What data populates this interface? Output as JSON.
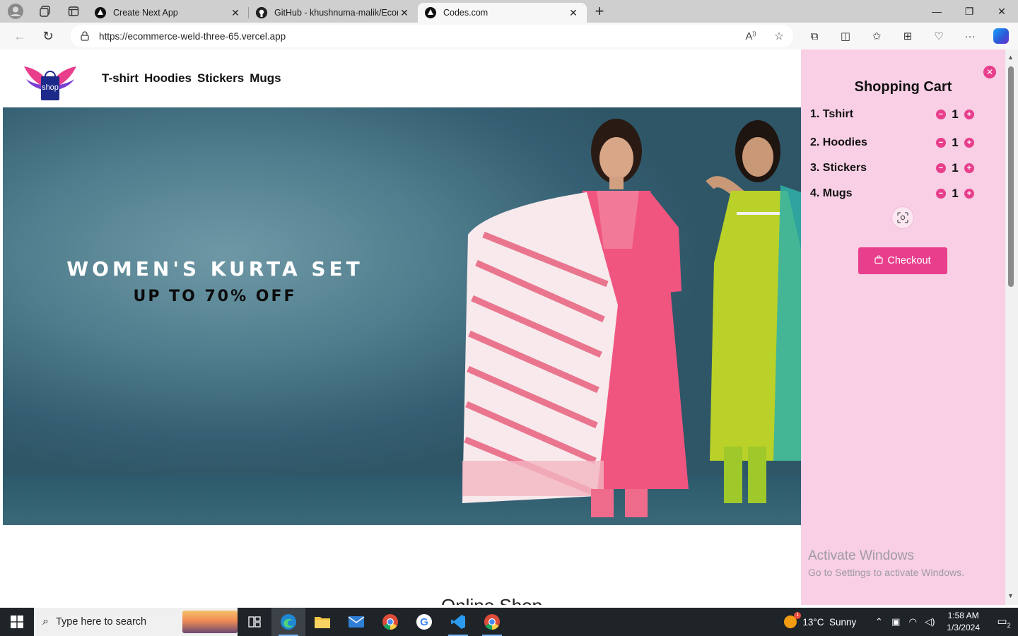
{
  "browser": {
    "tabs": [
      {
        "title": "Create Next App",
        "icon": "nextjs-icon",
        "active": false
      },
      {
        "title": "GitHub - khushnuma-malik/Ecom",
        "icon": "github-icon",
        "active": false
      },
      {
        "title": "Codes.com",
        "icon": "nextjs-icon",
        "active": true
      }
    ],
    "new_tab": "+",
    "address": {
      "url": "https://ecommerce-weld-three-65.vercel.app"
    }
  },
  "site": {
    "logo_text": "shop",
    "nav": [
      "T-shirt",
      "Hoodies",
      "Stickers",
      "Mugs"
    ],
    "hero": {
      "headline": "WOMEN'S KURTA SET",
      "subheadline": "UP TO 70% OFF"
    },
    "section_title": "Online Shop"
  },
  "cart": {
    "title": "Shopping Cart",
    "items": [
      {
        "label": "1. Tshirt",
        "qty": "1"
      },
      {
        "label": "2. Hoodies",
        "qty": "1"
      },
      {
        "label": "3. Stickers",
        "qty": "1"
      },
      {
        "label": "4. Mugs",
        "qty": "1"
      }
    ],
    "checkout_label": "Checkout"
  },
  "watermark": {
    "line1": "Activate Windows",
    "line2": "Go to Settings to activate Windows."
  },
  "taskbar": {
    "search_placeholder": "Type here to search",
    "weather": "13°C  Sunny",
    "weather_badge": "1",
    "time": "1:58 AM",
    "date": "1/3/2024",
    "notifications": "2"
  },
  "colors": {
    "accent": "#e83e8c",
    "cart_bg": "#f8cfe4",
    "hero_bg": "#4f7d8d"
  }
}
